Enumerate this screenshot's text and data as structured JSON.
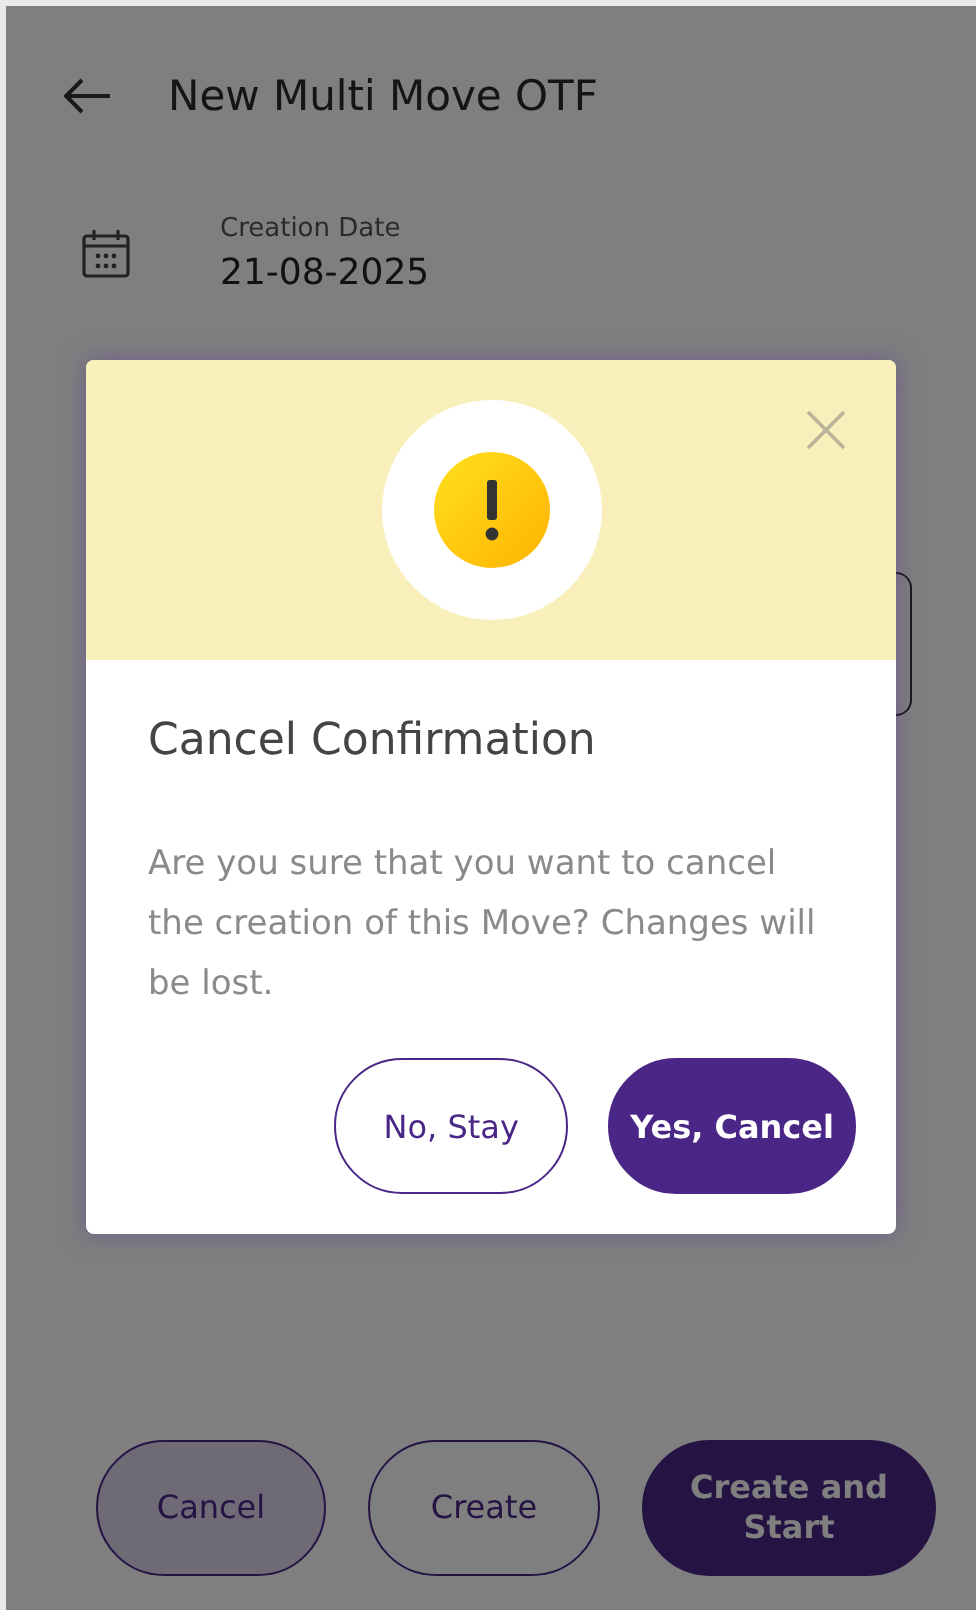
{
  "header": {
    "title": "New Multi Move OTF"
  },
  "creation_date": {
    "label": "Creation Date",
    "value": "21-08-2025"
  },
  "footer_buttons": [
    {
      "label": "Cancel",
      "kind": "secondary"
    },
    {
      "label": "Create",
      "kind": "outline"
    },
    {
      "label": "Create and Start",
      "kind": "primary"
    }
  ],
  "dialog": {
    "title": "Cancel Confirmation",
    "message": "Are you sure that you want to cancel the creation of this Move? Changes will be lost.",
    "buttons": [
      {
        "label": "No, Stay",
        "kind": "outline"
      },
      {
        "label": "Yes, Cancel",
        "kind": "primary"
      }
    ]
  }
}
